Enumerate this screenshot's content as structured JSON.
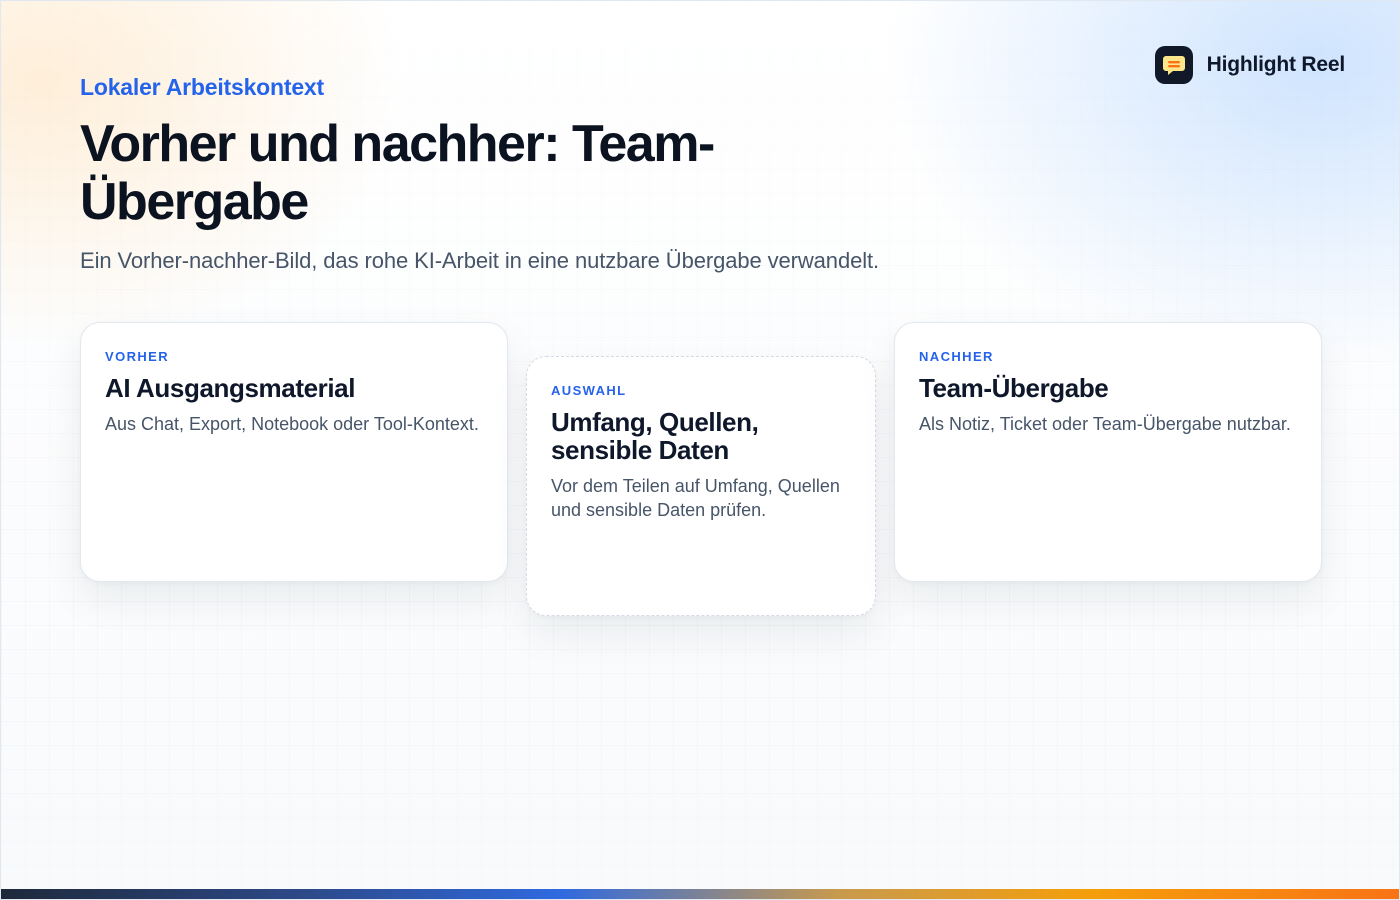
{
  "brand": {
    "name": "Highlight Reel",
    "icon": "chat-bubble-icon",
    "colors": {
      "icon_bg": "#111827",
      "bubble": "#fde68a",
      "lines": "#f97316"
    }
  },
  "header": {
    "eyebrow": "Lokaler Arbeitskontext",
    "title": "Vorher und nachher: Team-Übergabe",
    "subtitle": "Ein Vorher-nachher-Bild, das rohe KI-Arbeit in eine nutzbare Übergabe verwandelt."
  },
  "cards": [
    {
      "label": "VORHER",
      "title": "AI Ausgangsmaterial",
      "text": "Aus Chat, Export, Notebook oder Tool-Kontext."
    },
    {
      "label": "AUSWAHL",
      "title": "Umfang, Quellen, sensible Daten",
      "text": "Vor dem Teilen auf Umfang, Quellen und sensible Daten prüfen."
    },
    {
      "label": "NACHHER",
      "title": "Team-Übergabe",
      "text": "Als Notiz, Ticket oder Team-Übergabe nutzbar."
    }
  ],
  "colors": {
    "accent": "#2563eb",
    "heading": "#0b1220",
    "muted": "#475569",
    "bar_gradient": [
      "#1e293b",
      "#2f6ae0",
      "#f59e0b",
      "#f97316"
    ]
  }
}
